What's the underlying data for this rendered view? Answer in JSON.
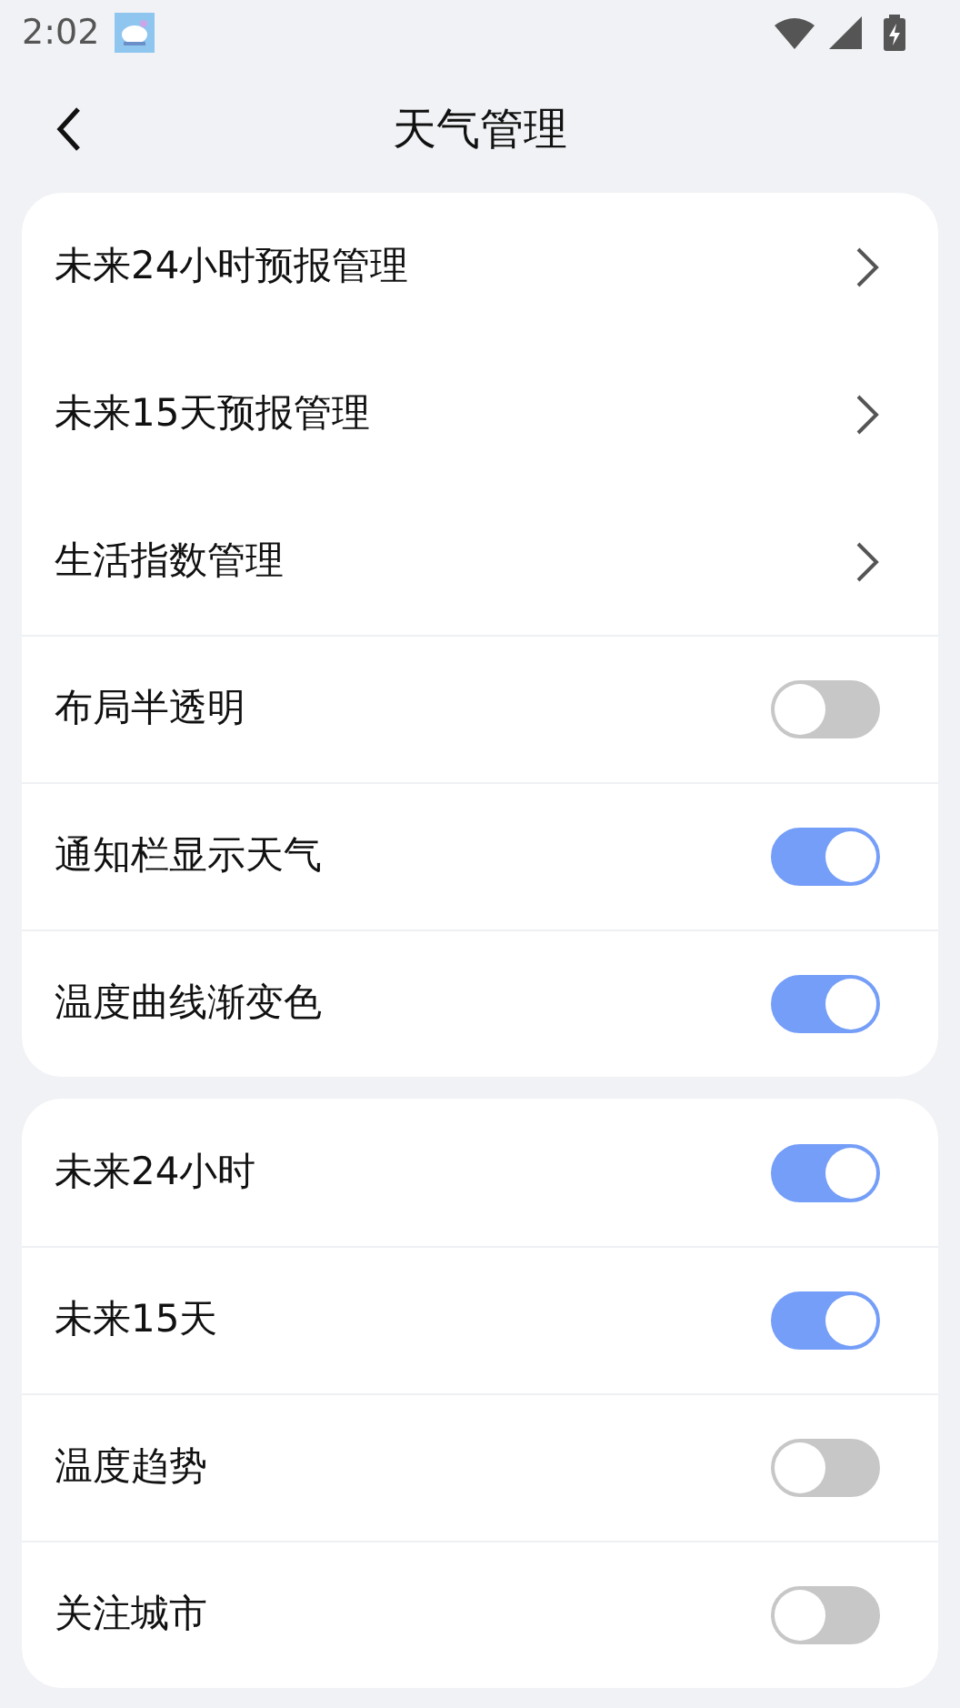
{
  "status_bar": {
    "time": "2:02"
  },
  "header": {
    "title": "天气管理"
  },
  "groups": [
    {
      "items": [
        {
          "kind": "link",
          "label": "未来24小时预报管理"
        },
        {
          "kind": "link",
          "label": "未来15天预报管理"
        },
        {
          "kind": "link",
          "label": "生活指数管理"
        },
        {
          "kind": "toggle",
          "label": "布局半透明",
          "on": false
        },
        {
          "kind": "toggle",
          "label": "通知栏显示天气",
          "on": true
        },
        {
          "kind": "toggle",
          "label": "温度曲线渐变色",
          "on": true
        }
      ]
    },
    {
      "items": [
        {
          "kind": "toggle",
          "label": "未来24小时",
          "on": true
        },
        {
          "kind": "toggle",
          "label": "未来15天",
          "on": true
        },
        {
          "kind": "toggle",
          "label": "温度趋势",
          "on": false
        },
        {
          "kind": "toggle",
          "label": "关注城市",
          "on": false
        }
      ]
    }
  ]
}
